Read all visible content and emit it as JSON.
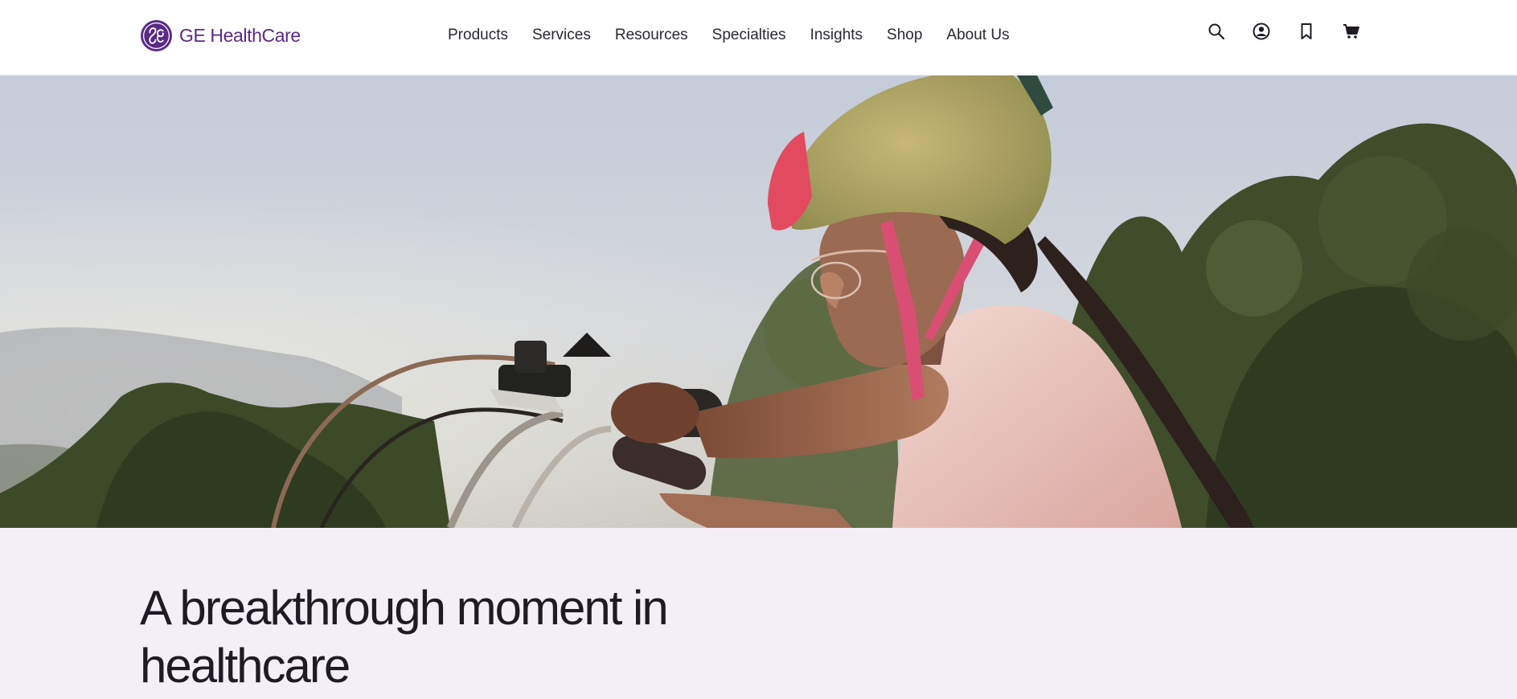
{
  "brand": {
    "name": "GE HealthCare",
    "logo_icon": "ge-monogram-icon",
    "accent_color": "#5b2a86"
  },
  "nav": {
    "items": [
      {
        "label": "Products"
      },
      {
        "label": "Services"
      },
      {
        "label": "Resources"
      },
      {
        "label": "Specialties"
      },
      {
        "label": "Insights"
      },
      {
        "label": "Shop"
      },
      {
        "label": "About Us"
      }
    ]
  },
  "utilities": [
    {
      "icon": "search-icon"
    },
    {
      "icon": "account-icon"
    },
    {
      "icon": "bookmark-icon"
    },
    {
      "icon": "cart-icon"
    }
  ],
  "hero": {
    "image": "girl-in-helmet-riding-bicycle-photo"
  },
  "headline": {
    "text": "A breakthrough moment in healthcare"
  },
  "colors": {
    "band_background": "#f4eff7",
    "text": "#1f1a24"
  }
}
